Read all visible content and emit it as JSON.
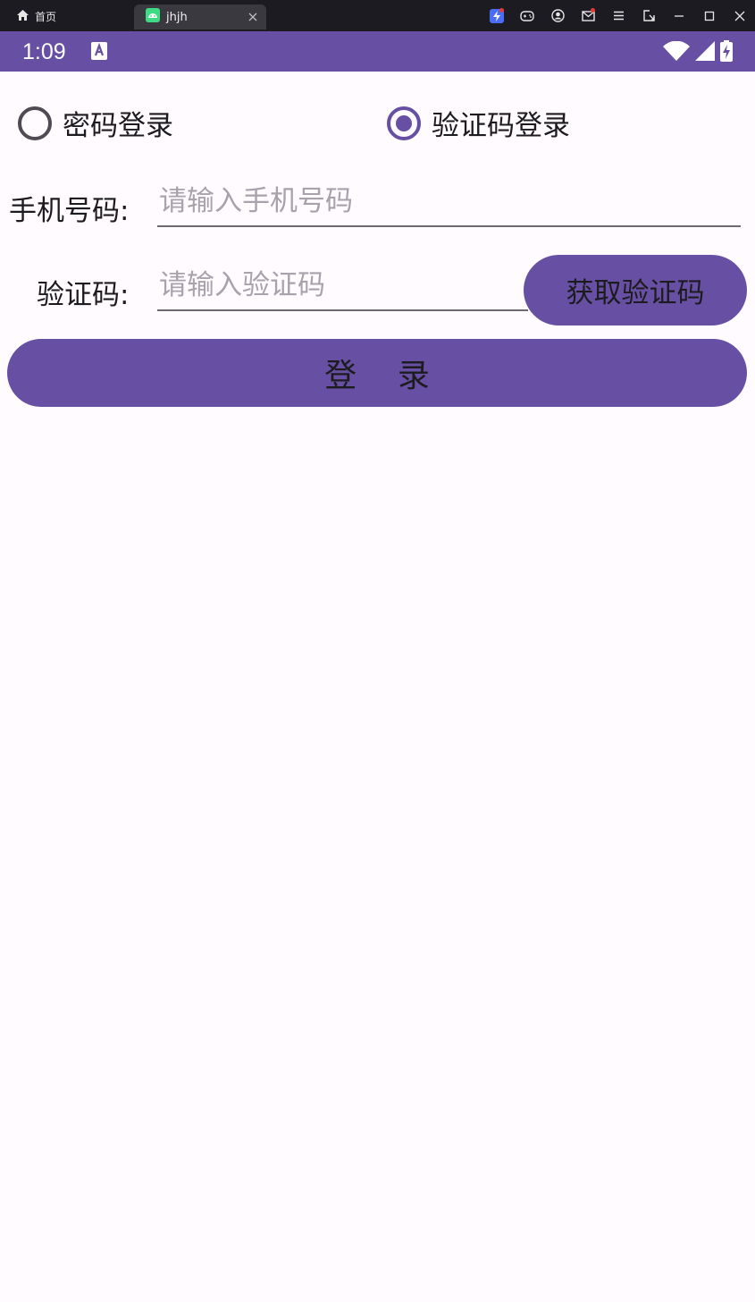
{
  "emulator": {
    "home_tab_label": "首页",
    "app_tab_label": "jhjh"
  },
  "status_bar": {
    "time": "1:09",
    "bar_color": "#6750a4"
  },
  "login_mode": {
    "options": [
      {
        "label": "密码登录",
        "checked": false
      },
      {
        "label": "验证码登录",
        "checked": true
      }
    ]
  },
  "form": {
    "phone_label": "手机号码:",
    "phone_placeholder": "请输入手机号码",
    "phone_value": "",
    "code_label": "验证码:",
    "code_placeholder": "请输入验证码",
    "code_value": "",
    "get_code_button": "获取验证码",
    "login_button": "登    录"
  },
  "colors": {
    "accent": "#6750a4",
    "background": "#fffbfe"
  }
}
